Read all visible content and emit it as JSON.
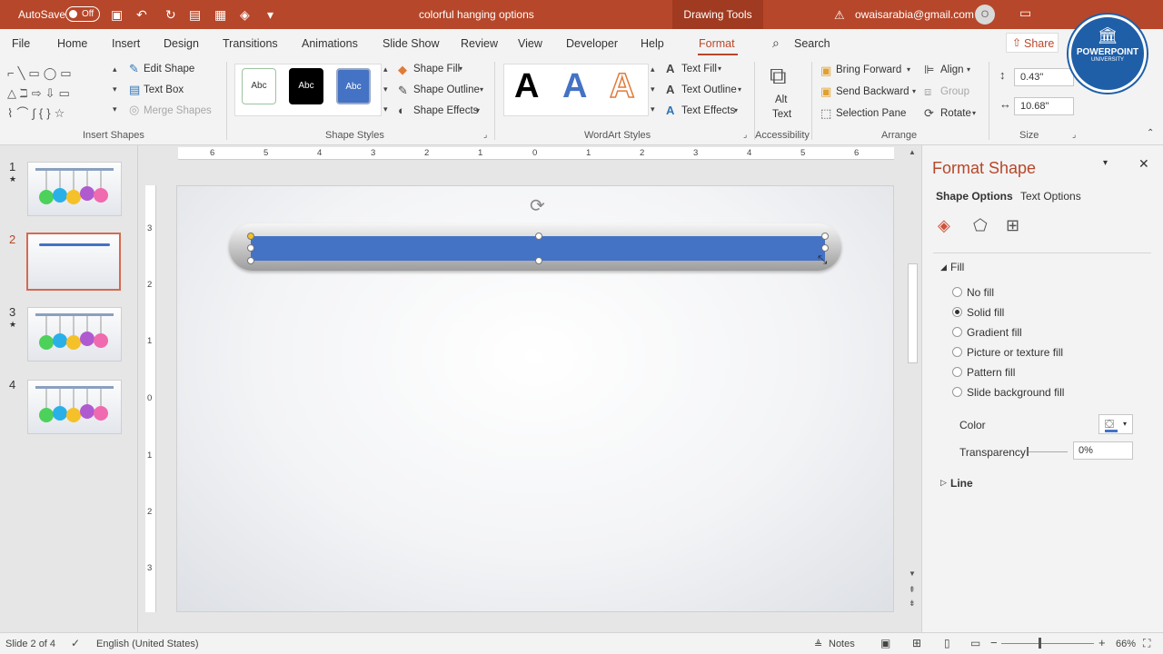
{
  "titlebar": {
    "autosave_label": "AutoSave",
    "autosave_state": "Off",
    "doc_title": "colorful hanging options",
    "context_tab": "Drawing Tools",
    "user_email": "owaisarabia@gmail.com",
    "user_initial": "O"
  },
  "tabs": [
    "File",
    "Home",
    "Insert",
    "Design",
    "Transitions",
    "Animations",
    "Slide Show",
    "Review",
    "View",
    "Developer",
    "Help",
    "Format"
  ],
  "active_tab": "Format",
  "search_label": "Search",
  "share_label": "Share",
  "ribbon": {
    "insert_shapes": {
      "edit_shape": "Edit Shape",
      "text_box": "Text Box",
      "merge_shapes": "Merge Shapes",
      "label": "Insert Shapes"
    },
    "shape_styles": {
      "swatches": [
        "Abc",
        "Abc",
        "Abc"
      ],
      "shape_fill": "Shape Fill",
      "shape_outline": "Shape Outline",
      "shape_effects": "Shape Effects",
      "label": "Shape Styles"
    },
    "wordart": {
      "letters": [
        "A",
        "A",
        "A"
      ],
      "text_fill": "Text Fill",
      "text_outline": "Text Outline",
      "text_effects": "Text Effects",
      "label": "WordArt Styles"
    },
    "accessibility": {
      "alt_text_line1": "Alt",
      "alt_text_line2": "Text",
      "label": "Accessibility"
    },
    "arrange": {
      "bring_forward": "Bring Forward",
      "send_backward": "Send Backward",
      "selection_pane": "Selection Pane",
      "align": "Align",
      "group": "Group",
      "rotate": "Rotate",
      "label": "Arrange"
    },
    "size": {
      "height": "0.43\"",
      "width": "10.68\"",
      "label": "Size"
    }
  },
  "logo": {
    "line1": "POWERPOINT",
    "line2": "UNIVERSITY"
  },
  "thumbnails": [
    {
      "num": "1",
      "star": "★"
    },
    {
      "num": "2",
      "star": ""
    },
    {
      "num": "3",
      "star": "★"
    },
    {
      "num": "4",
      "star": ""
    }
  ],
  "selected_slide": 2,
  "hruler": [
    "6",
    "5",
    "4",
    "3",
    "2",
    "1",
    "0",
    "1",
    "2",
    "3",
    "4",
    "5",
    "6"
  ],
  "vruler": [
    "3",
    "2",
    "1",
    "0",
    "1",
    "2",
    "3"
  ],
  "pane": {
    "title": "Format Shape",
    "tab_shape": "Shape Options",
    "tab_text": "Text Options",
    "fill_header": "Fill",
    "fill_options": [
      "No fill",
      "Solid fill",
      "Gradient fill",
      "Picture or texture fill",
      "Pattern fill",
      "Slide background fill"
    ],
    "selected_fill": "Solid fill",
    "color_label": "Color",
    "transparency_label": "Transparency",
    "transparency_value": "0%",
    "line_header": "Line"
  },
  "status": {
    "slide_info": "Slide 2 of 4",
    "language": "English (United States)",
    "notes": "Notes",
    "zoom": "66%"
  },
  "colors": {
    "accent": "#b7472a",
    "shape_blue": "#4472c4"
  }
}
